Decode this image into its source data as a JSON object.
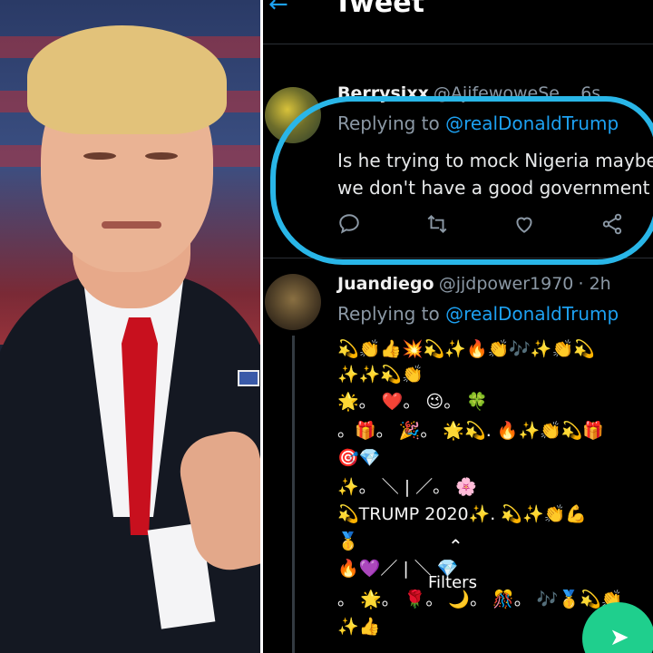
{
  "header": {
    "title": "Tweet",
    "back_icon": "arrow-left-icon"
  },
  "tweet1": {
    "name": "Berrysixx",
    "handle": "@AjifewoweSe...",
    "time": "6s",
    "replying_prefix": "Replying to",
    "replying_to": "@realDonaldTrump",
    "body_line1": "Is he trying to mock Nigeria maybe",
    "body_line2": "we don't have a good government",
    "actions": {
      "reply_icon": "💬",
      "retweet_icon": "⟲",
      "like_icon": "♡",
      "share_icon": "share-icon"
    }
  },
  "tweet2": {
    "name": "Juandiego",
    "handle": "@jjdpower1970",
    "time": "· 2h",
    "replying_prefix": "Replying to",
    "replying_to": "@realDonaldTrump",
    "lines": [
      "💫👏👍💥💫✨🔥👏🎶✨👏💫",
      "✨✨💫👏",
      "🌟。 ❤️。 😉。 🍀",
      "。🎁。 🎉。 🌟💫.    🔥✨👏💫🎁",
      "🎯💎",
      "✨。 ＼ | ／。 🌸",
      "💫TRUMP 2020✨.    💫✨👏💪",
      "🥇",
      "🔥💜／ |  ＼  💎",
      "。 🌟。 🌹。 🌙。 🎊。 🎶🥇💫👏",
      "✨👍"
    ]
  },
  "filters": {
    "label": "Filters",
    "chevron": "⌃"
  },
  "fab": {
    "icon": "send-icon"
  },
  "colors": {
    "accent": "#1da1f2",
    "highlight": "#29b6e8",
    "fab": "#1fcf8d"
  }
}
